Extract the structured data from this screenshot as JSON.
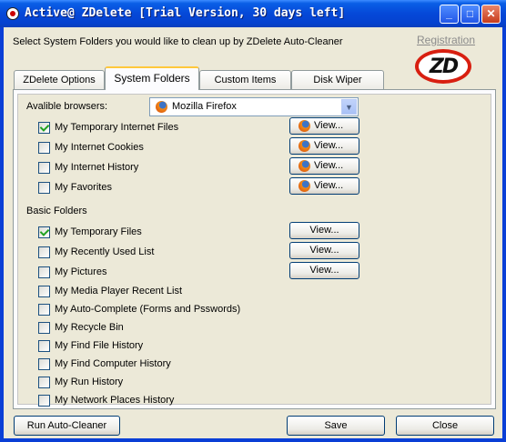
{
  "window": {
    "title": "Active@ ZDelete [Trial Version, 30 days left]"
  },
  "header": {
    "instruction": "Select System Folders you would like to clean up by ZDelete Auto-Cleaner",
    "registration_link": "Registration",
    "logo_text": "ZD"
  },
  "tabs": [
    {
      "label": "ZDelete Options",
      "active": false
    },
    {
      "label": "System Folders",
      "active": true
    },
    {
      "label": "Custom Items",
      "active": false
    },
    {
      "label": "Disk Wiper",
      "active": false
    }
  ],
  "browsers": {
    "label": "Avalible browsers:",
    "selected": "Mozilla Firefox",
    "items": [
      {
        "label": "My Temporary Internet Files",
        "checked": true,
        "button": "View..."
      },
      {
        "label": "My Internet Cookies",
        "checked": false,
        "button": "View..."
      },
      {
        "label": "My Internet History",
        "checked": false,
        "button": "View..."
      },
      {
        "label": "My Favorites",
        "checked": false,
        "button": "View..."
      }
    ]
  },
  "basic_folders": {
    "label": "Basic Folders",
    "items": [
      {
        "label": "My Temporary Files",
        "checked": true,
        "button": "View..."
      },
      {
        "label": "My Recently Used List",
        "checked": false,
        "button": "View..."
      },
      {
        "label": "My Pictures",
        "checked": false,
        "button": "View..."
      },
      {
        "label": "My Media Player Recent List",
        "checked": false
      },
      {
        "label": "My Auto-Complete (Forms and Psswords)",
        "checked": false
      },
      {
        "label": "My Recycle Bin",
        "checked": false
      },
      {
        "label": "My Find File History",
        "checked": false
      },
      {
        "label": "My Find Computer History",
        "checked": false
      },
      {
        "label": "My Run History",
        "checked": false
      },
      {
        "label": "My Network Places History",
        "checked": false
      }
    ]
  },
  "footer": {
    "run_label": "Run Auto-Cleaner",
    "save_label": "Save",
    "close_label": "Close"
  },
  "colors": {
    "title_bar": "#0548d8",
    "face": "#ece9d8",
    "tab_highlight": "#ffc83c",
    "logo_ring": "#d81f10"
  }
}
